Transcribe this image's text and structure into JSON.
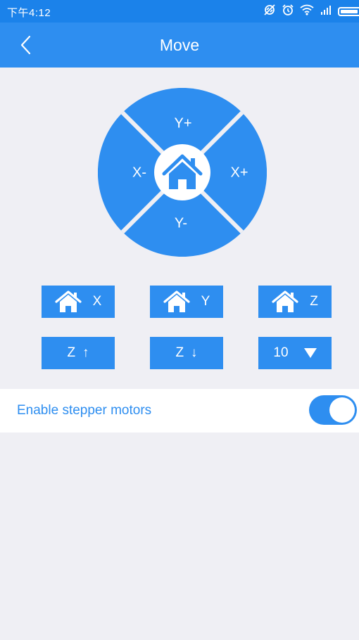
{
  "status_bar": {
    "time": "下午4:12",
    "icons": [
      "sync-off-icon",
      "alarm-icon",
      "wifi-icon",
      "signal-icon",
      "battery-icon"
    ]
  },
  "app_bar": {
    "title": "Move",
    "back_icon": "chevron-left-icon"
  },
  "dpad": {
    "up_label": "Y+",
    "down_label": "Y-",
    "left_label": "X-",
    "right_label": "X+",
    "center_icon": "home-icon"
  },
  "home_buttons": [
    {
      "label": "X",
      "icon": "home-icon"
    },
    {
      "label": "Y",
      "icon": "home-icon"
    },
    {
      "label": "Z",
      "icon": "home-icon"
    }
  ],
  "z_controls": {
    "z_up_label": "Z",
    "z_up_arrow": "↑",
    "z_down_label": "Z",
    "z_down_arrow": "↓"
  },
  "step_select": {
    "value": "10",
    "icon": "caret-down-icon"
  },
  "stepper_toggle": {
    "label": "Enable stepper motors",
    "enabled": true
  },
  "colors": {
    "primary": "#2e8ef0",
    "status_bar": "#1b82ea",
    "background": "#efeff4",
    "white": "#ffffff"
  }
}
